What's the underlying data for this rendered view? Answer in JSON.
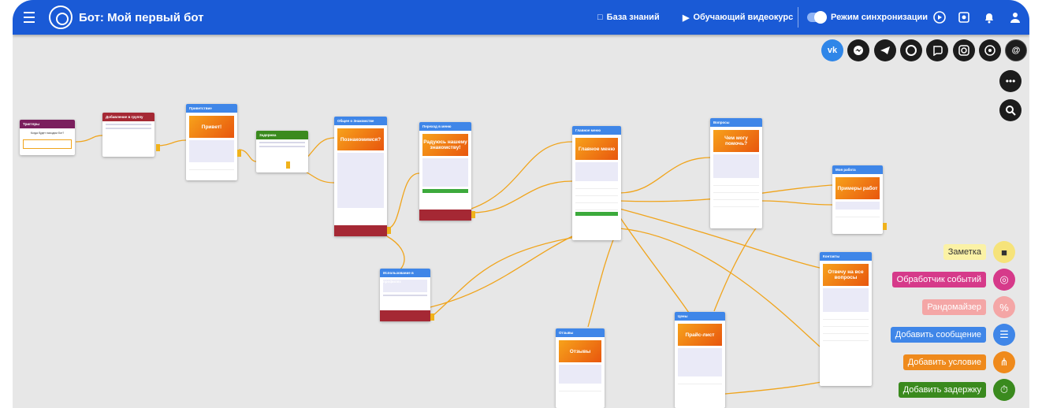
{
  "topbar": {
    "title": "Бот: Мой первый бот",
    "knowledge_base": "База знаний",
    "course": "Обучающий видеокурс",
    "sync_mode": "Режим синхронизации"
  },
  "channels": [
    "vk",
    "messenger",
    "telegram",
    "chat",
    "viber",
    "instagram",
    "whatsapp",
    "email"
  ],
  "colors": {
    "brand": "#1a5ad6",
    "canvas": "#e7e7e7",
    "connector": "#f0a41b",
    "node_header": "#3f86e8"
  },
  "nodes": [
    {
      "id": "n1",
      "title": "Триггеры",
      "header_color": "#7b1f5e",
      "question": "Когда будет находим бот?"
    },
    {
      "id": "n2",
      "title": "Добавление в группу",
      "header_color": "#a52834"
    },
    {
      "id": "n3",
      "title": "Приветствие",
      "header_color": "#3f86e8",
      "banner": "Привет!"
    },
    {
      "id": "n4",
      "title": "Задержка",
      "header_color": "#3a8a1e"
    },
    {
      "id": "n5",
      "title": "Общее о Знакомстве",
      "header_color": "#3f86e8",
      "banner": "Познакомимся?"
    },
    {
      "id": "n6",
      "title": "Переход в меню",
      "header_color": "#3f86e8",
      "banner": "Радуюсь нашему знакомству!"
    },
    {
      "id": "n7",
      "title": "Главное меню",
      "header_color": "#3f86e8",
      "banner": "Главное меню"
    },
    {
      "id": "n8",
      "title": "Вопросы",
      "header_color": "#3f86e8",
      "banner": "Чем могу помочь?"
    },
    {
      "id": "n9",
      "title": "Моя работа",
      "header_color": "#3f86e8",
      "banner": "Примеры работ"
    },
    {
      "id": "n10",
      "title": "Контакты",
      "header_color": "#3f86e8",
      "banner": "Отвечу на все вопросы"
    },
    {
      "id": "n11",
      "title": "Цены",
      "header_color": "#3f86e8",
      "banner": "Прайс-лист"
    },
    {
      "id": "n12",
      "title": "Отзывы",
      "header_color": "#3f86e8",
      "banner": "Отзывы"
    },
    {
      "id": "n13",
      "title": "Использование в профилях",
      "header_color": "#3f86e8"
    }
  ],
  "tools": [
    {
      "label": "Заметка",
      "label_bg": "#fbf2a6",
      "label_color": "#333333",
      "btn": "#f6e37a",
      "icon": "note-icon"
    },
    {
      "label": "Обработчик событий",
      "label_bg": "#d63a8a",
      "label_color": "#ffffff",
      "btn": "#d63a8a",
      "icon": "target-icon"
    },
    {
      "label": "Рандомайзер",
      "label_bg": "#f4a6a6",
      "label_color": "#ffffff",
      "btn": "#f4a6a6",
      "icon": "percent-icon"
    },
    {
      "label": "Добавить сообщение",
      "label_bg": "#3f86e8",
      "label_color": "#ffffff",
      "btn": "#3f86e8",
      "icon": "message-icon"
    },
    {
      "label": "Добавить условие",
      "label_bg": "#ef8a1c",
      "label_color": "#ffffff",
      "btn": "#ef8a1c",
      "icon": "fork-icon"
    },
    {
      "label": "Добавить задержку",
      "label_bg": "#3a8a1e",
      "label_color": "#ffffff",
      "btn": "#3a8a1e",
      "icon": "timer-icon"
    }
  ]
}
